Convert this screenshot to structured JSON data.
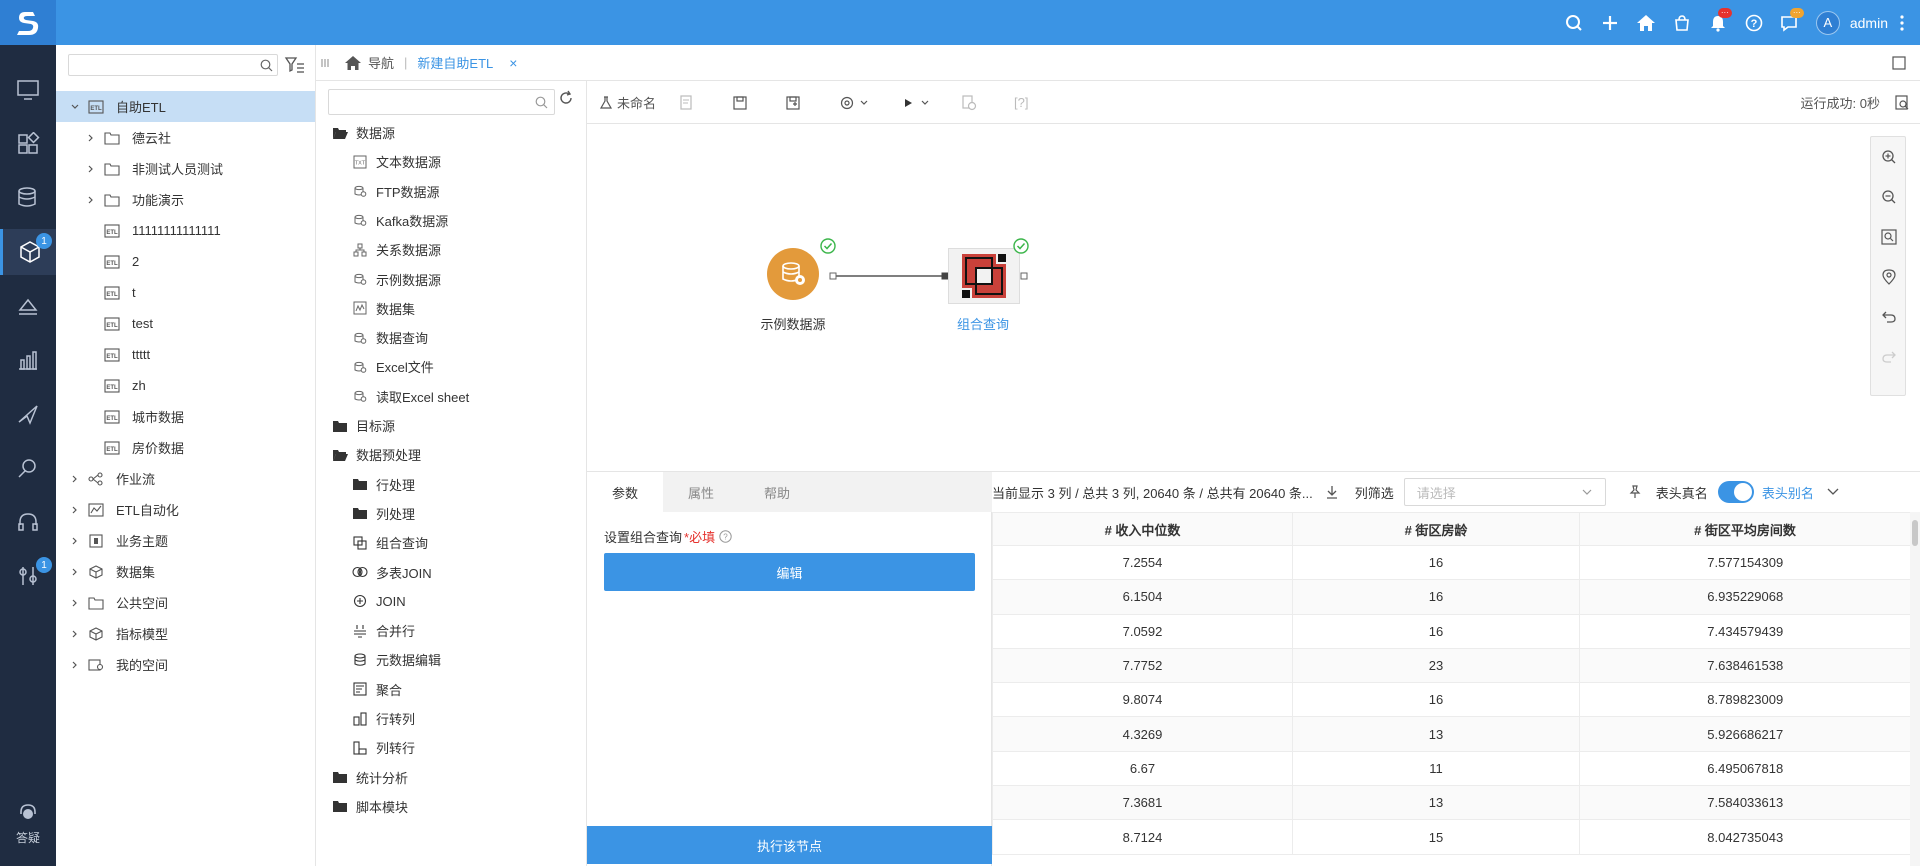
{
  "topbar": {
    "avatar_letter": "A",
    "username": "admin",
    "notif_badge": "···",
    "chat_badge": "···"
  },
  "rail": {
    "badge1": "1",
    "badge2": "1",
    "help_label": "答疑"
  },
  "tree": {
    "items": [
      {
        "label": "自助ETL"
      },
      {
        "label": "德云社"
      },
      {
        "label": "非测试人员测试"
      },
      {
        "label": "功能演示"
      },
      {
        "label": "11111111111111"
      },
      {
        "label": "2"
      },
      {
        "label": "t"
      },
      {
        "label": "test"
      },
      {
        "label": "ttttt"
      },
      {
        "label": "zh"
      },
      {
        "label": "城市数据"
      },
      {
        "label": "房价数据"
      },
      {
        "label": "作业流"
      },
      {
        "label": "ETL自动化"
      },
      {
        "label": "业务主题"
      },
      {
        "label": "数据集"
      },
      {
        "label": "公共空间"
      },
      {
        "label": "指标模型"
      },
      {
        "label": "我的空间"
      }
    ]
  },
  "breadcrumb": {
    "nav_label": "导航",
    "tab_label": "新建自助ETL"
  },
  "components": {
    "items": [
      {
        "label": "数据源"
      },
      {
        "label": "文本数据源"
      },
      {
        "label": "FTP数据源"
      },
      {
        "label": "Kafka数据源"
      },
      {
        "label": "关系数据源"
      },
      {
        "label": "示例数据源"
      },
      {
        "label": "数据集"
      },
      {
        "label": "数据查询"
      },
      {
        "label": "Excel文件"
      },
      {
        "label": "读取Excel sheet"
      },
      {
        "label": "目标源"
      },
      {
        "label": "数据预处理"
      },
      {
        "label": "行处理"
      },
      {
        "label": "列处理"
      },
      {
        "label": "组合查询"
      },
      {
        "label": "多表JOIN"
      },
      {
        "label": "JOIN"
      },
      {
        "label": "合并行"
      },
      {
        "label": "元数据编辑"
      },
      {
        "label": "聚合"
      },
      {
        "label": "行转列"
      },
      {
        "label": "列转行"
      },
      {
        "label": "统计分析"
      },
      {
        "label": "脚本模块"
      }
    ]
  },
  "toolbar": {
    "unnamed_label": "未命名",
    "run_status": "运行成功: 0秒",
    "help_label": "[?]"
  },
  "canvas": {
    "node1_label": "示例数据源",
    "node2_label": "组合查询"
  },
  "props": {
    "tabs": [
      "参数",
      "属性",
      "帮助"
    ],
    "field_label": "设置组合查询",
    "required_label": "*必填",
    "edit_button": "编辑",
    "execute_button": "执行该节点"
  },
  "grid": {
    "summary": "当前显示 3 列 / 总共 3 列,  20640 条 / 总共有 20640 条...",
    "col_filter_label": "列筛选",
    "col_filter_placeholder": "请选择",
    "real_name_label": "表头真名",
    "alias_label": "表头别名",
    "columns": [
      "# 收入中位数",
      "# 街区房龄",
      "# 街区平均房间数"
    ],
    "rows": [
      [
        "7.2554",
        "16",
        "7.577154309"
      ],
      [
        "6.1504",
        "16",
        "6.935229068"
      ],
      [
        "7.0592",
        "16",
        "7.434579439"
      ],
      [
        "7.7752",
        "23",
        "7.638461538"
      ],
      [
        "9.8074",
        "16",
        "8.789823009"
      ],
      [
        "4.3269",
        "13",
        "5.926686217"
      ],
      [
        "6.67",
        "11",
        "6.495067818"
      ],
      [
        "7.3681",
        "13",
        "7.584033613"
      ],
      [
        "8.7124",
        "15",
        "8.042735043"
      ]
    ]
  },
  "colors": {
    "topbar": "#3b94e4",
    "rail": "#1f2c41",
    "accent": "#3b94e4",
    "node_source": "#e39a3b",
    "node_query": "#c9413a",
    "success": "#3bb54a"
  }
}
